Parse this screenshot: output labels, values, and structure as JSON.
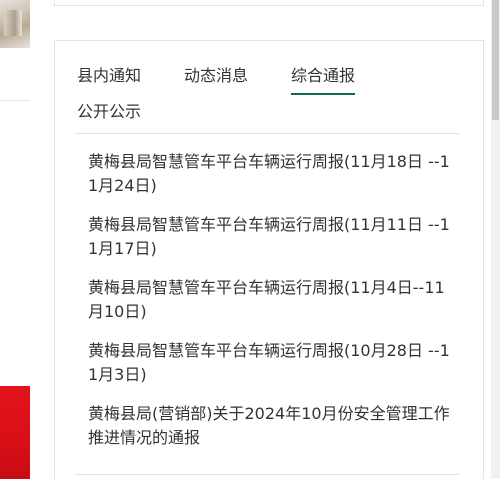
{
  "tabs": [
    {
      "label": "县内通知",
      "active": false
    },
    {
      "label": "动态消息",
      "active": false
    },
    {
      "label": "综合通报",
      "active": true
    },
    {
      "label": "公开公示",
      "active": false
    }
  ],
  "news": [
    {
      "title": "黄梅县局智慧管车平台车辆运行周报(11月18日 --11月24日)"
    },
    {
      "title": "黄梅县局智慧管车平台车辆运行周报(11月11日 --11月17日)"
    },
    {
      "title": "黄梅县局智慧管车平台车辆运行周报(11月4日--11月10日)"
    },
    {
      "title": "黄梅县局智慧管车平台车辆运行周报(10月28日 --11月3日)"
    },
    {
      "title": "黄梅县局(营销部)关于2024年10月份安全管理工作推进情况的通报"
    }
  ],
  "colors": {
    "accent": "#0e6b4c",
    "banner_red": "#e3131b"
  }
}
